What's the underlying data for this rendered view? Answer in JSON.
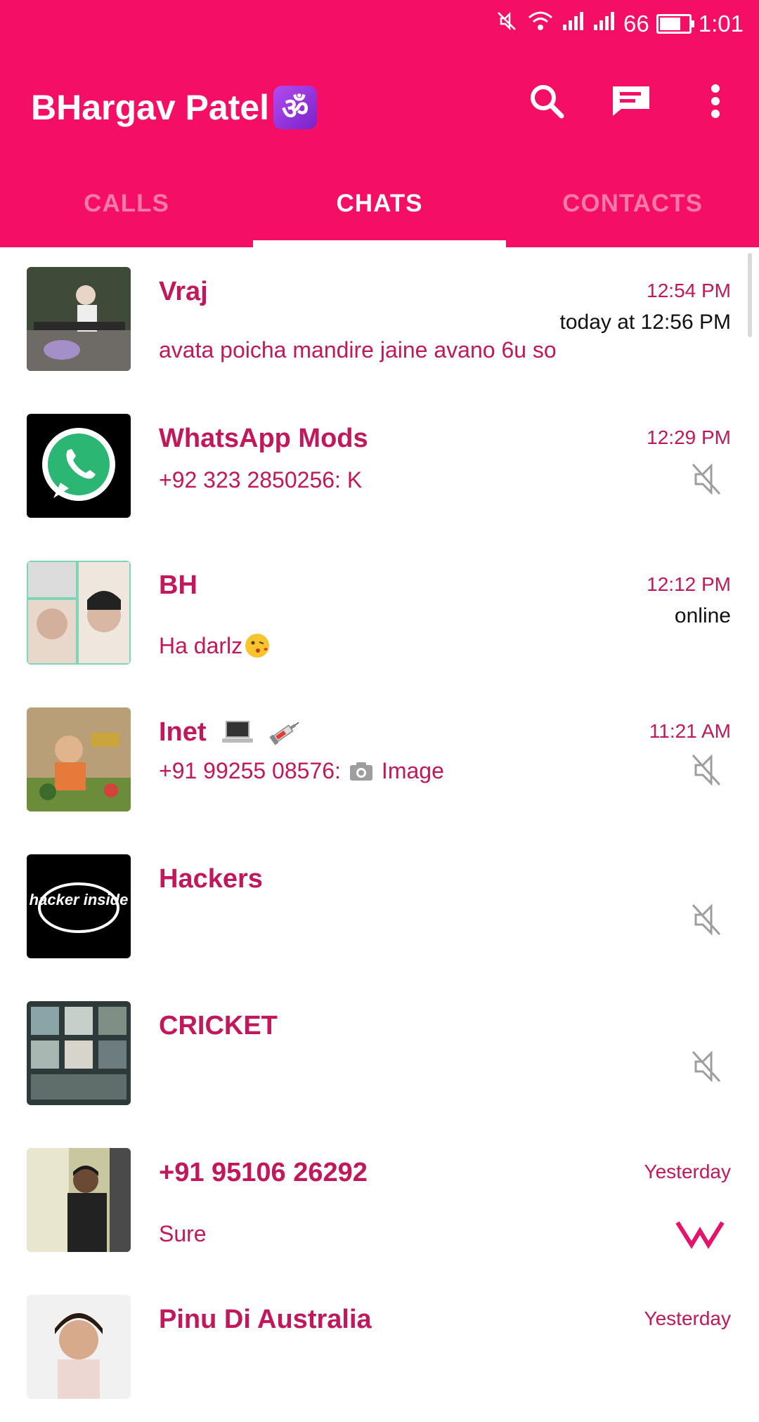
{
  "status_bar": {
    "battery": "66",
    "time": "1:01"
  },
  "header": {
    "title": "BHargav Patel",
    "title_emoji": "ॐ"
  },
  "tabs": [
    {
      "label": "CALLS",
      "active": false
    },
    {
      "label": "CHATS",
      "active": true
    },
    {
      "label": "CONTACTS",
      "active": false
    }
  ],
  "chats": [
    {
      "name": "Vraj",
      "message": "avata poicha mandire jaine avano 6u so",
      "time": "12:54 PM",
      "status": "today at 12:56 PM"
    },
    {
      "name": "WhatsApp Mods",
      "message": "+92 323 2850256: K",
      "time": "12:29 PM",
      "muted": true
    },
    {
      "name": "BH",
      "message": "Ha darlz",
      "time": "12:12 PM",
      "status": "online"
    },
    {
      "name": "Inet",
      "message_prefix": "+91 99255 08576:",
      "message": "Image",
      "time": "11:21 AM",
      "muted": true
    },
    {
      "name": "Hackers",
      "muted": true,
      "avatar_text": "hacker inside"
    },
    {
      "name": "CRICKET",
      "muted": true
    },
    {
      "name": "+91 95106 26292",
      "message": "Sure",
      "time": "Yesterday"
    },
    {
      "name": "Pinu Di Australia",
      "time": "Yesterday"
    }
  ],
  "colors": {
    "primary": "#f50e65",
    "name_text": "#c2185b"
  }
}
